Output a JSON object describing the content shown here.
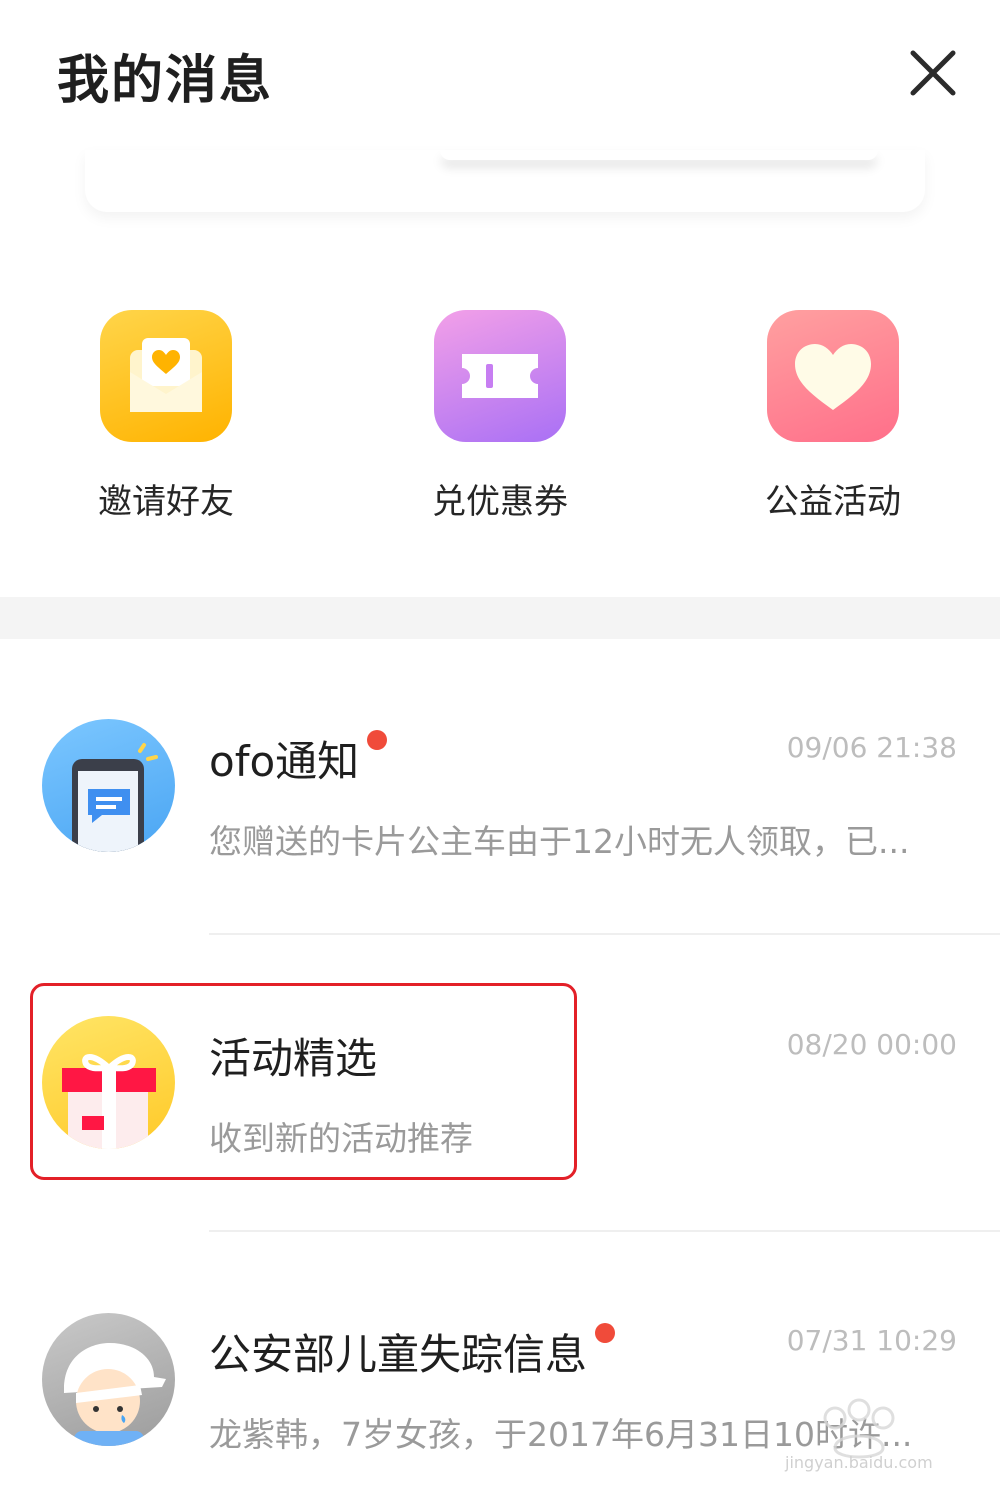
{
  "header": {
    "title": "我的消息",
    "close_icon": "close-icon"
  },
  "quick_actions": [
    {
      "label": "邀请好友",
      "icon": "envelope-heart-icon",
      "color": "#ffc107"
    },
    {
      "label": "兑优惠券",
      "icon": "ticket-icon",
      "color": "#c776f0"
    },
    {
      "label": "公益活动",
      "icon": "heart-icon",
      "color": "#ff7b8a"
    }
  ],
  "messages": [
    {
      "title": "ofo通知",
      "unread": true,
      "time": "09/06 21:38",
      "preview": "您赠送的卡片公主车由于12小时无人领取，已...",
      "avatar_icon": "phone-message-icon"
    },
    {
      "title": "活动精选",
      "unread": false,
      "time": "08/20 00:00",
      "preview": "收到新的活动推荐",
      "avatar_icon": "gift-icon",
      "highlighted": true
    },
    {
      "title": "公安部儿童失踪信息",
      "unread": true,
      "time": "07/31 10:29",
      "preview": "龙紫韩，7岁女孩，于2017年6月31日10时许...",
      "avatar_icon": "crying-child-icon"
    }
  ],
  "colors": {
    "unread_dot": "#f04b3a",
    "highlight_border": "#e32028"
  }
}
